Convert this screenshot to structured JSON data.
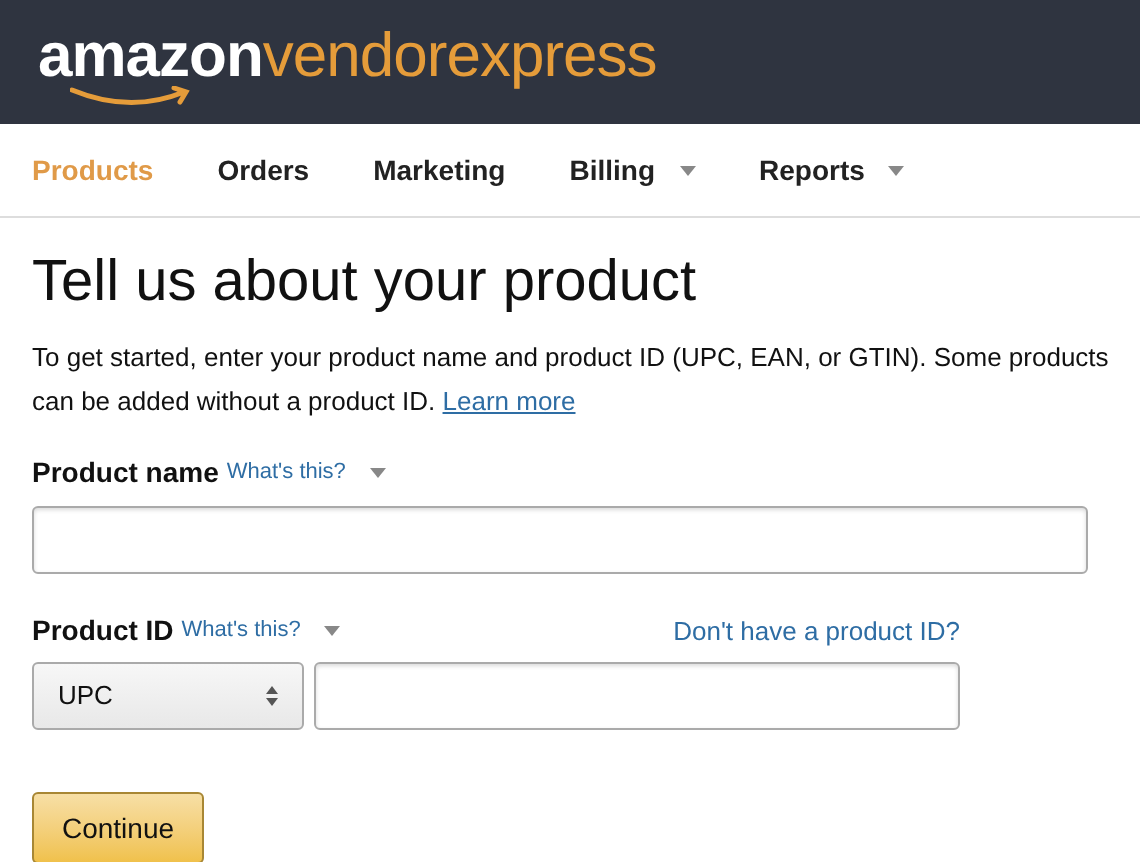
{
  "logo": {
    "brand": "amazon",
    "product": "vendorexpress"
  },
  "nav": [
    {
      "label": "Products",
      "selected": true,
      "has_menu": false
    },
    {
      "label": "Orders",
      "selected": false,
      "has_menu": false
    },
    {
      "label": "Marketing",
      "selected": false,
      "has_menu": false
    },
    {
      "label": "Billing",
      "selected": false,
      "has_menu": true
    },
    {
      "label": "Reports",
      "selected": false,
      "has_menu": true
    }
  ],
  "title": "Tell us about your product",
  "intro": {
    "text": "To get started, enter your product name and product ID (UPC, EAN, or GTIN). Some products can be added without a product ID.",
    "link": "Learn more"
  },
  "product_name": {
    "label": "Product name",
    "help": "What's this?"
  },
  "product_id": {
    "label": "Product ID",
    "help": "What's this?",
    "alt_link": "Don't have a product ID?",
    "type": "UPC"
  },
  "continue_button": "Continue"
}
